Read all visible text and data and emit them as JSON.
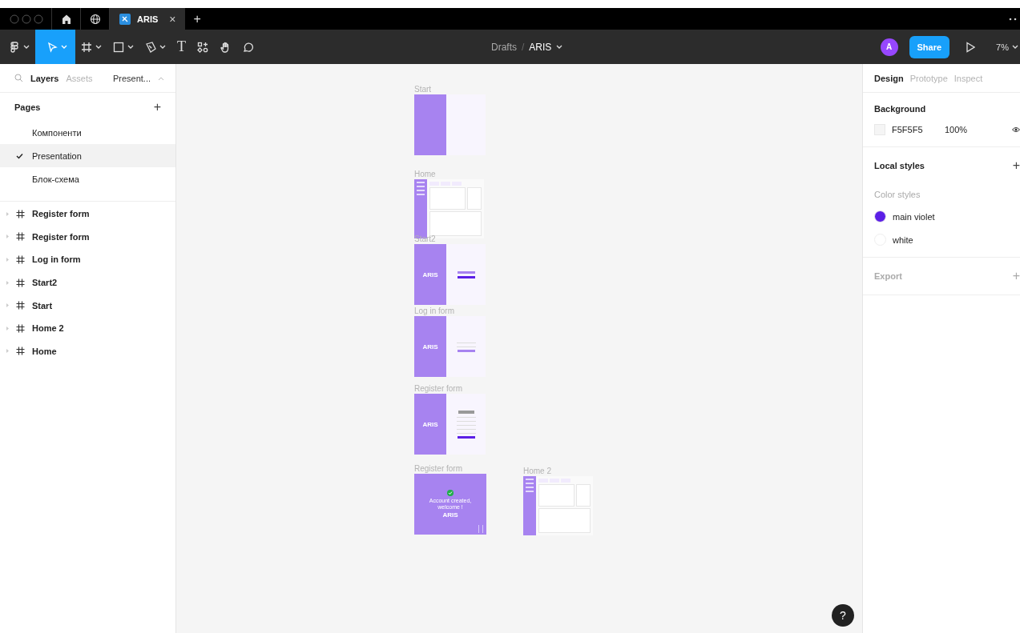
{
  "tab_bar": {
    "tabs": [
      {
        "label": "ARIS",
        "close": "×",
        "selected": true
      }
    ],
    "new_tab": "+"
  },
  "toolbar": {
    "tools": [
      {
        "kind": "main-menu",
        "caret": true,
        "selected": false
      },
      {
        "kind": "move",
        "caret": true,
        "selected": true
      },
      {
        "kind": "frame",
        "caret": true,
        "selected": false
      },
      {
        "kind": "shape",
        "caret": true,
        "selected": false
      },
      {
        "kind": "pen",
        "caret": true,
        "selected": false
      },
      {
        "kind": "text",
        "label": "T",
        "caret": false,
        "selected": false
      },
      {
        "kind": "resources",
        "caret": false,
        "selected": false
      },
      {
        "kind": "hand",
        "caret": false,
        "selected": false
      },
      {
        "kind": "comment",
        "caret": false,
        "selected": false
      }
    ],
    "breadcrumb": {
      "folder": "Drafts",
      "separator": "/",
      "file": "ARIS"
    },
    "avatar": "A",
    "share": "Share",
    "zoom": "7%"
  },
  "left_panel": {
    "tabs": [
      {
        "label": "Layers",
        "selected": true
      },
      {
        "label": "Assets",
        "selected": false
      }
    ],
    "page_selector": "Present...",
    "pages_title": "Pages",
    "add": "+",
    "pages": [
      {
        "label": "Компоненти",
        "selected": false
      },
      {
        "label": "Presentation",
        "selected": true
      },
      {
        "label": "Блок-схема",
        "selected": false
      }
    ],
    "layers": [
      "Register form",
      "Register form",
      "Log in form",
      "Start2",
      "Start",
      "Home 2",
      "Home"
    ]
  },
  "canvas": {
    "frames": [
      {
        "label": "Start",
        "kind": "start"
      },
      {
        "label": "Home",
        "kind": "home"
      },
      {
        "label": "Start2",
        "kind": "start2",
        "logo": "ARIS"
      },
      {
        "label": "Log in form",
        "kind": "login",
        "logo": "ARIS"
      },
      {
        "label": "Register form",
        "kind": "register",
        "logo": "ARIS"
      },
      {
        "label": "Register form",
        "kind": "success",
        "message": "Account created, welcome !",
        "logo": "ARIS"
      },
      {
        "label": "Home 2",
        "kind": "home"
      }
    ]
  },
  "right_panel": {
    "tabs": [
      {
        "label": "Design",
        "selected": true
      },
      {
        "label": "Prototype",
        "selected": false
      },
      {
        "label": "Inspect",
        "selected": false
      }
    ],
    "background": {
      "title": "Background",
      "hex": "F5F5F5",
      "opacity": "100%"
    },
    "local_styles": {
      "title": "Local styles",
      "add": "+",
      "subtitle": "Color styles",
      "styles": [
        {
          "name": "main violet",
          "color": "#5b1fe6"
        },
        {
          "name": "white",
          "color": "#ffffff"
        }
      ]
    },
    "export": {
      "title": "Export",
      "add": "+"
    }
  },
  "help": "?"
}
